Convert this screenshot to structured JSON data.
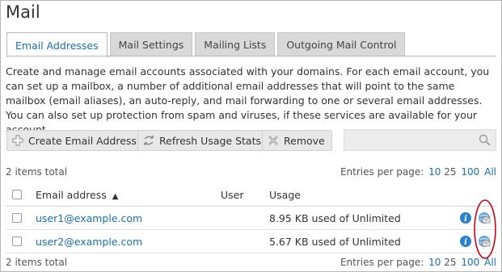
{
  "page": {
    "title": "Mail"
  },
  "tabs": [
    {
      "label": "Email Addresses",
      "active": true
    },
    {
      "label": "Mail Settings",
      "active": false
    },
    {
      "label": "Mailing Lists",
      "active": false
    },
    {
      "label": "Outgoing Mail Control",
      "active": false
    }
  ],
  "description": "Create and manage email accounts associated with your domains. For each email account, you can set up a mailbox, a number of additional email addresses that will point to the same mailbox (email aliases), an auto-reply, and mail forwarding to one or several email addresses. You can also set up protection from spam and viruses, if these services are available for your account.",
  "toolbar": {
    "create_label": "Create Email Address",
    "refresh_label": "Refresh Usage Stats",
    "remove_label": "Remove",
    "search_placeholder": ""
  },
  "listing": {
    "total_text": "2 items total",
    "per_page_label": "Entries per page:",
    "per_page_options": [
      "10",
      "25",
      "100",
      "All"
    ],
    "per_page_selected": "25"
  },
  "table": {
    "columns": {
      "email": "Email address",
      "sort_indicator": "▲",
      "user": "User",
      "usage": "Usage"
    },
    "rows": [
      {
        "email": "user1@example.com",
        "user": "",
        "usage": "8.95 KB used of Unlimited"
      },
      {
        "email": "user2@example.com",
        "user": "",
        "usage": "5.67 KB used of Unlimited"
      }
    ]
  },
  "colors": {
    "link": "#1a6fb5",
    "annotation": "#d0021b",
    "tab_inactive_bg": "#d9d9d9"
  }
}
